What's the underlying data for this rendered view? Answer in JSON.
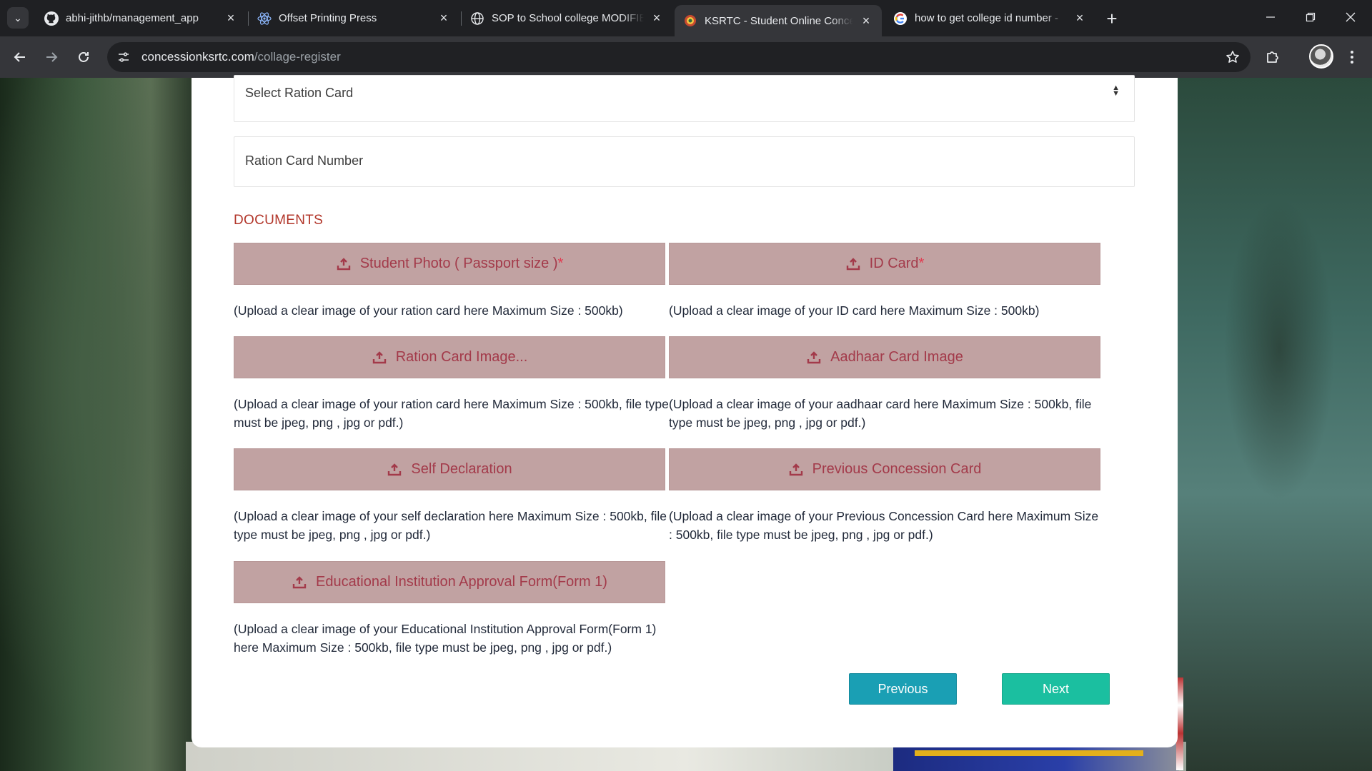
{
  "browser": {
    "tabs": [
      {
        "title": "abhi-jithb/management_app",
        "icon": "github-icon"
      },
      {
        "title": "Offset Printing Press",
        "icon": "react-icon"
      },
      {
        "title": "SOP to School college MODIFIE",
        "icon": "globe-icon"
      },
      {
        "title": "KSRTC - Student Online Conces",
        "icon": "ksrtc-icon",
        "active": true
      },
      {
        "title": "how to get college id number -",
        "icon": "google-icon"
      }
    ],
    "url_domain": "concessionksrtc.com",
    "url_path": "/collage-register"
  },
  "form": {
    "ration_card_select": "Select Ration Card",
    "ration_card_number_placeholder": "Ration Card Number",
    "documents_title": "DOCUMENTS",
    "uploads": [
      {
        "label": "Student Photo ( Passport size )",
        "required": "*",
        "hint": "(Upload a clear image of your ration card here Maximum Size : 500kb)"
      },
      {
        "label": "ID Card",
        "required": "*",
        "hint": "(Upload a clear image of your ID card here Maximum Size : 500kb)"
      },
      {
        "label": "Ration Card Image...",
        "required": "",
        "hint": "(Upload a clear image of your ration card here Maximum Size : 500kb, file type must be jpeg, png , jpg or pdf.)"
      },
      {
        "label": "Aadhaar Card Image",
        "required": "",
        "hint": "(Upload a clear image of your aadhaar card here Maximum Size : 500kb, file type must be jpeg, png , jpg or pdf.)"
      },
      {
        "label": "Self Declaration",
        "required": "",
        "hint": "(Upload a clear image of your self declaration here Maximum Size : 500kb, file type must be jpeg, png , jpg or pdf.)"
      },
      {
        "label": "Previous Concession Card",
        "required": "",
        "hint": "(Upload a clear image of your Previous Concession Card here Maximum Size : 500kb, file type must be jpeg, png , jpg or pdf.)"
      },
      {
        "label": "Educational Institution Approval Form(Form 1)",
        "required": "",
        "hint": "(Upload a clear image of your Educational Institution Approval Form(Form 1) here Maximum Size : 500kb, file type must be jpeg, png , jpg or pdf.)"
      }
    ],
    "previous_label": "Previous",
    "next_label": "Next"
  },
  "colors": {
    "upload_bg": "#c1a2a2",
    "upload_text": "#a33a4a",
    "section_title": "#b2362a",
    "previous_button": "#1a9fb4",
    "next_button": "#1bbfa0"
  }
}
